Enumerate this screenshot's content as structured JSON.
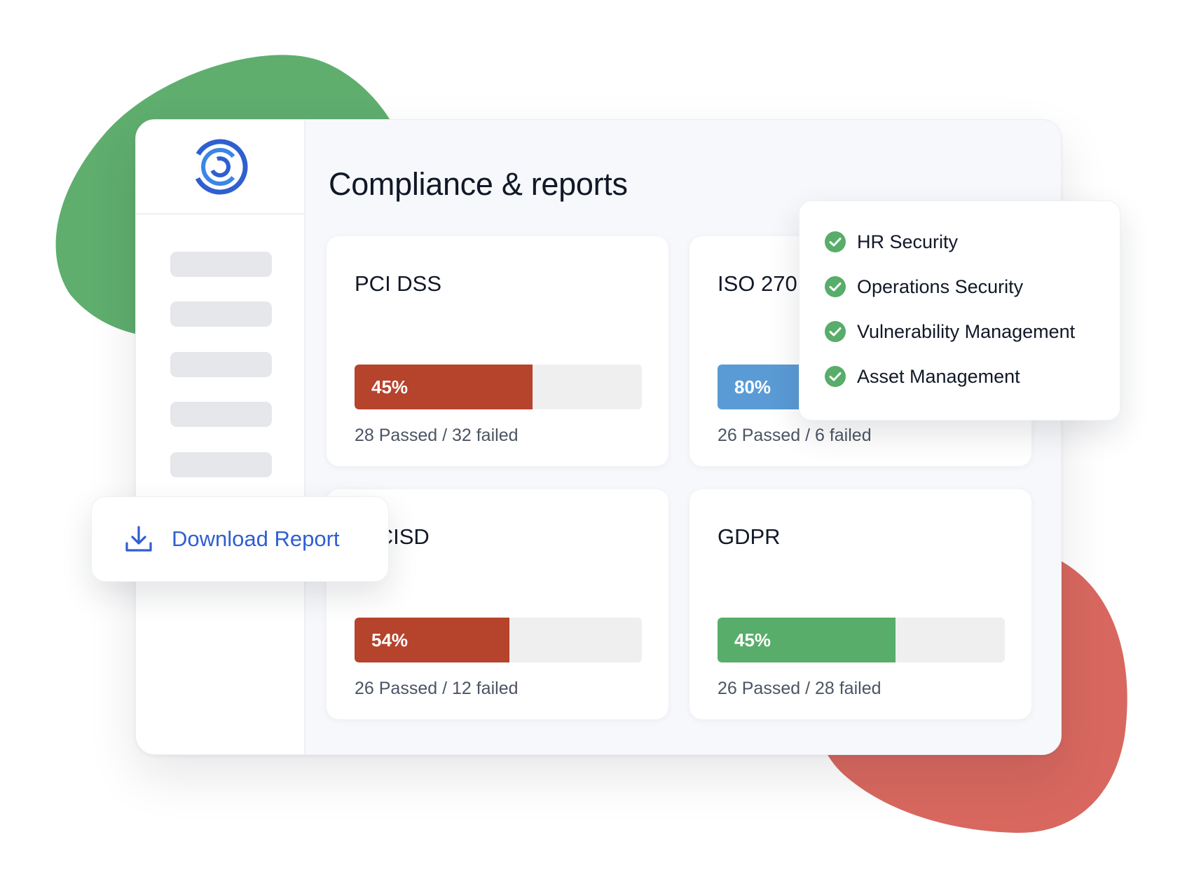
{
  "colors": {
    "background_blob_green": "#5fae6e",
    "background_blob_red": "#d8685f",
    "progress_red": "#b6432c",
    "progress_blue": "#5a9bd5",
    "progress_green": "#57ad69",
    "check_green": "#57ad69",
    "link_blue": "#2f5fd0",
    "logo_blue": "#2f5fd0"
  },
  "header": {
    "title": "Compliance & reports"
  },
  "sidebar": {
    "logo_icon": "concentric-rings-logo",
    "nav_placeholders": 5
  },
  "cards": [
    {
      "title": "PCI DSS",
      "percent_label": "45%",
      "progress": 0.62,
      "color": "#b6432c",
      "passed_label": "28 Passed",
      "failed_label": "32 failed"
    },
    {
      "title": "ISO 270",
      "percent_label": "80%",
      "progress": 0.82,
      "color": "#5a9bd5",
      "passed_label": "26 Passed",
      "failed_label": "6 failed"
    },
    {
      "title": "G CISD",
      "percent_label": "54%",
      "progress": 0.54,
      "color": "#b6432c",
      "passed_label": "26 Passed",
      "failed_label": "12 failed"
    },
    {
      "title": "GDPR",
      "percent_label": "45%",
      "progress": 0.62,
      "color": "#57ad69",
      "passed_label": "26 Passed",
      "failed_label": "28 failed"
    }
  ],
  "checklist": {
    "icon": "check-circle-icon",
    "items": [
      {
        "label": "HR Security"
      },
      {
        "label": "Operations Security"
      },
      {
        "label": "Vulnerability Management"
      },
      {
        "label": "Asset Management"
      }
    ]
  },
  "download": {
    "icon": "download-icon",
    "label": "Download Report"
  }
}
